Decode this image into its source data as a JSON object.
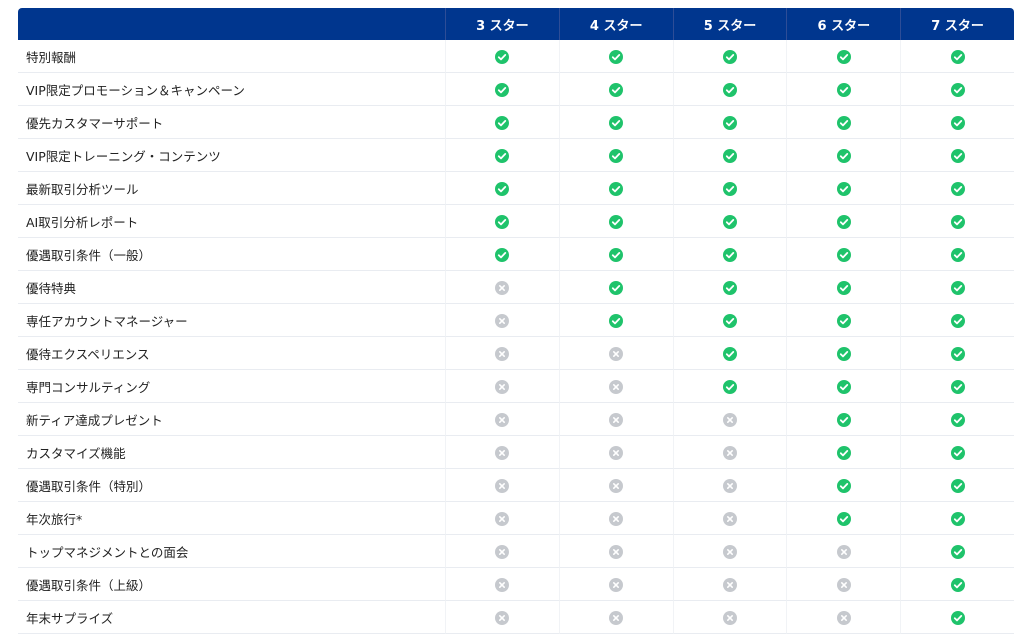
{
  "colors": {
    "header_bg": "#00368e",
    "check": "#1fc36b",
    "cross": "#c6c9ce"
  },
  "header": {
    "tiers": [
      "3 スター",
      "4 スター",
      "5 スター",
      "6 スター",
      "7 スター"
    ]
  },
  "rows": [
    {
      "label": "特別報酬",
      "values": [
        true,
        true,
        true,
        true,
        true
      ]
    },
    {
      "label": "VIP限定プロモーション＆キャンペーン",
      "values": [
        true,
        true,
        true,
        true,
        true
      ]
    },
    {
      "label": "優先カスタマーサポート",
      "values": [
        true,
        true,
        true,
        true,
        true
      ]
    },
    {
      "label": "VIP限定トレーニング・コンテンツ",
      "values": [
        true,
        true,
        true,
        true,
        true
      ]
    },
    {
      "label": "最新取引分析ツール",
      "values": [
        true,
        true,
        true,
        true,
        true
      ]
    },
    {
      "label": "AI取引分析レポート",
      "values": [
        true,
        true,
        true,
        true,
        true
      ]
    },
    {
      "label": "優遇取引条件（一般）",
      "values": [
        true,
        true,
        true,
        true,
        true
      ]
    },
    {
      "label": "優待特典",
      "values": [
        false,
        true,
        true,
        true,
        true
      ]
    },
    {
      "label": "専任アカウントマネージャー",
      "values": [
        false,
        true,
        true,
        true,
        true
      ]
    },
    {
      "label": "優待エクスペリエンス",
      "values": [
        false,
        false,
        true,
        true,
        true
      ]
    },
    {
      "label": "専門コンサルティング",
      "values": [
        false,
        false,
        true,
        true,
        true
      ]
    },
    {
      "label": "新ティア達成プレゼント",
      "values": [
        false,
        false,
        false,
        true,
        true
      ]
    },
    {
      "label": "カスタマイズ機能",
      "values": [
        false,
        false,
        false,
        true,
        true
      ]
    },
    {
      "label": "優遇取引条件（特別）",
      "values": [
        false,
        false,
        false,
        true,
        true
      ]
    },
    {
      "label": "年次旅行*",
      "values": [
        false,
        false,
        false,
        true,
        true
      ]
    },
    {
      "label": "トップマネジメントとの面会",
      "values": [
        false,
        false,
        false,
        false,
        true
      ]
    },
    {
      "label": "優遇取引条件（上級）",
      "values": [
        false,
        false,
        false,
        false,
        true
      ]
    },
    {
      "label": "年末サプライズ",
      "values": [
        false,
        false,
        false,
        false,
        true
      ]
    }
  ]
}
